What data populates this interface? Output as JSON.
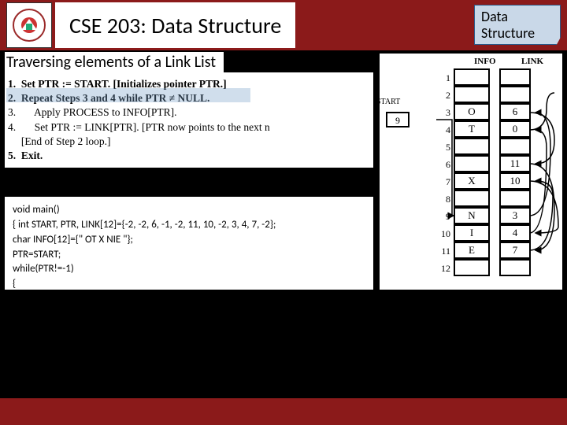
{
  "header": {
    "title": "CSE 203: Data Structure",
    "badge_line1": "Data",
    "badge_line2": "Structure"
  },
  "subtitle": "Traversing elements of a Link List",
  "algorithm": {
    "l1": "1.  Set PTR := START. [Initializes pointer PTR.]",
    "l2": "2.  Repeat Steps 3 and 4 while PTR ≠ NULL.",
    "l3": "3.       Apply PROCESS to INFO[PTR].",
    "l4": "4.       Set PTR := LINK[PTR]. [PTR now points to the next n",
    "l5": "     [End of Step 2 loop.]",
    "l6": "5.  Exit."
  },
  "code": {
    "l1": "void main()",
    "l2": "{  int START, PTR, LINK[12]={-2, -2, 6, -1, -2,  11, 10, -2, 3, 4, 7, -2};",
    "l3": "char INFO[12]={\"   OT  X  NIE \"};",
    "l4": "PTR=START;",
    "l5": "while(PTR!=-1)",
    "l6": "{"
  },
  "table": {
    "start_label": "START",
    "start_value": "9",
    "header_info": "INFO",
    "header_link": "LINK",
    "rows": [
      {
        "n": "1",
        "info": "",
        "link": ""
      },
      {
        "n": "2",
        "info": "",
        "link": ""
      },
      {
        "n": "3",
        "info": "O",
        "link": "6"
      },
      {
        "n": "4",
        "info": "T",
        "link": "0"
      },
      {
        "n": "5",
        "info": "",
        "link": ""
      },
      {
        "n": "6",
        "info": "",
        "link": "11"
      },
      {
        "n": "7",
        "info": "X",
        "link": "10"
      },
      {
        "n": "8",
        "info": "",
        "link": ""
      },
      {
        "n": "9",
        "info": "N",
        "link": "3"
      },
      {
        "n": "10",
        "info": "I",
        "link": "4"
      },
      {
        "n": "11",
        "info": "E",
        "link": "7"
      },
      {
        "n": "12",
        "info": "",
        "link": ""
      }
    ]
  }
}
